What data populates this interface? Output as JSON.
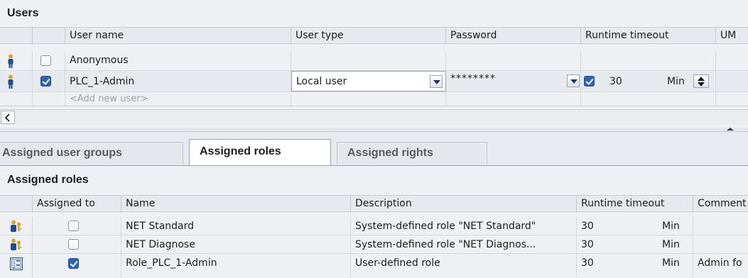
{
  "users": {
    "title": "Users",
    "columns": {
      "user_name": "User name",
      "user_type": "User type",
      "password": "Password",
      "runtime_timeout": "Runtime timeout",
      "um": "UM"
    },
    "rows": [
      {
        "name": "Anonymous",
        "checked": false
      },
      {
        "name": "PLC_1-Admin",
        "checked": true,
        "user_type": "Local user",
        "password": "********",
        "timeout_checked": true,
        "timeout": "30",
        "unit": "Min"
      }
    ],
    "add_new": "<Add new user>"
  },
  "tabs": [
    {
      "label": "Assigned user groups",
      "active": false
    },
    {
      "label": "Assigned roles",
      "active": true
    },
    {
      "label": "Assigned rights",
      "active": false
    }
  ],
  "roles": {
    "title": "Assigned roles",
    "columns": {
      "assigned_to": "Assigned to",
      "name": "Name",
      "description": "Description",
      "runtime_timeout": "Runtime timeout",
      "comment": "Comment"
    },
    "rows": [
      {
        "icon": "role-group-icon",
        "checked": false,
        "name": "NET Standard",
        "description": "System-defined role \"NET Standard\"",
        "timeout": "30",
        "unit": "Min",
        "comment": ""
      },
      {
        "icon": "role-group-icon",
        "checked": false,
        "name": "NET Diagnose",
        "description": "System-defined role \"NET Diagnos...",
        "timeout": "30",
        "unit": "Min",
        "comment": ""
      },
      {
        "icon": "user-role-icon",
        "checked": true,
        "name": "Role_PLC_1-Admin",
        "description": "User-defined role",
        "timeout": "30",
        "unit": "Min",
        "comment": "Admin fo"
      }
    ]
  }
}
